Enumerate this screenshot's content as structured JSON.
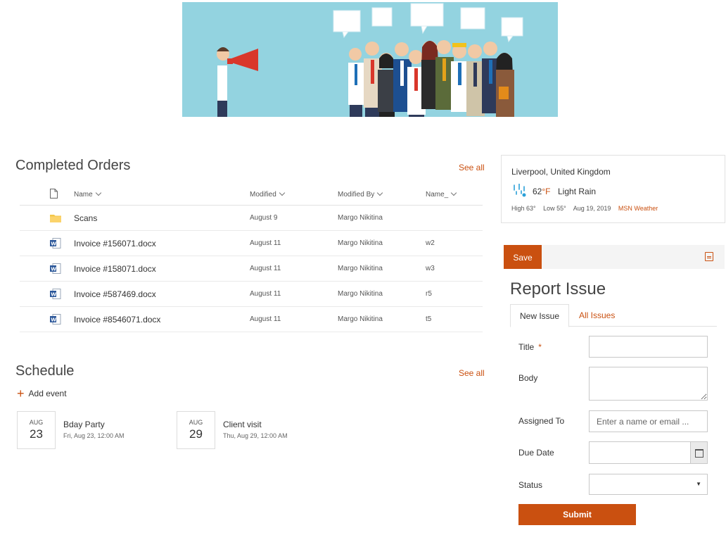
{
  "orders": {
    "title": "Completed Orders",
    "see_all": "See all",
    "columns": {
      "name": "Name",
      "modified": "Modified",
      "modified_by": "Modified By",
      "name2": "Name_"
    },
    "rows": [
      {
        "icon": "folder-icon",
        "name": "Scans",
        "modified": "August 9",
        "modified_by": "Margo Nikitina",
        "name2": ""
      },
      {
        "icon": "word-doc-icon",
        "name": "Invoice #156071.docx",
        "modified": "August 11",
        "modified_by": "Margo Nikitina",
        "name2": "w2"
      },
      {
        "icon": "word-doc-icon",
        "name": "Invoice #158071.docx",
        "modified": "August 11",
        "modified_by": "Margo Nikitina",
        "name2": "w3"
      },
      {
        "icon": "word-doc-icon",
        "name": "Invoice #587469.docx",
        "modified": "August 11",
        "modified_by": "Margo Nikitina",
        "name2": "r5"
      },
      {
        "icon": "word-doc-icon",
        "name": "Invoice #8546071.docx",
        "modified": "August 11",
        "modified_by": "Margo Nikitina",
        "name2": "t5"
      }
    ]
  },
  "schedule": {
    "title": "Schedule",
    "see_all": "See all",
    "add_event": "Add event",
    "events": [
      {
        "month": "AUG",
        "day": "23",
        "title": "Bday Party",
        "when": "Fri, Aug 23, 12:00 AM"
      },
      {
        "month": "AUG",
        "day": "29",
        "title": "Client visit",
        "when": "Thu, Aug 29, 12:00 AM"
      }
    ]
  },
  "weather": {
    "location": "Liverpool, United Kingdom",
    "temp": "62",
    "unit": "°F",
    "condition": "Light Rain",
    "high": "High 63°",
    "low": "Low 55°",
    "date": "Aug 19, 2019",
    "source": "MSN Weather",
    "icon": "rain-icon"
  },
  "report": {
    "save_label": "Save",
    "title": "Report Issue",
    "tabs": {
      "new": "New Issue",
      "all": "All Issues"
    },
    "fields": {
      "title": "Title",
      "required_mark": "*",
      "body": "Body",
      "assigned_to": "Assigned To",
      "assigned_placeholder": "Enter a name or email ...",
      "due_date": "Due Date",
      "status": "Status"
    },
    "submit_label": "Submit"
  },
  "colors": {
    "accent": "#ca5010",
    "banner_bg": "#93d3e0"
  }
}
